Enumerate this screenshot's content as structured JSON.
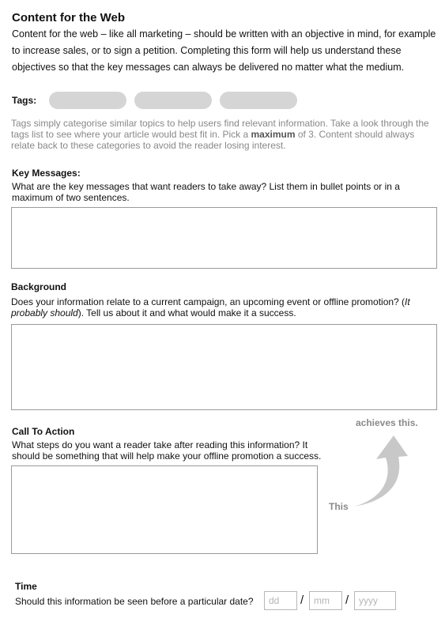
{
  "header": {
    "title": "Content for the Web",
    "intro": "Content for the web – like all marketing – should be written with an objective in mind, for example to increase sales, or to sign a petition. Completing this form will help us understand these objectives so that the key messages can always be delivered no matter what the medium."
  },
  "tags": {
    "label": "Tags:",
    "help_part1": "Tags simply categorise similar topics to help users find relevant information. Take a look through the tags list to see where your article would best fit in. Pick a ",
    "help_bold": "maximum",
    "help_part2": " of 3. Content should always relate back to these categories to avoid the reader losing interest."
  },
  "key_messages": {
    "label": "Key Messages:",
    "help": "What are the key messages that want readers to take away? List them in bullet points or in a maximum of two sentences."
  },
  "background": {
    "label": "Background",
    "help_part1": "Does your information relate to a current campaign, an upcoming event or offline promotion? (",
    "help_italic": "It probably should",
    "help_part2": "). Tell us about it and what would make it a success."
  },
  "call_to_action": {
    "label": "Call To Action",
    "help": "What steps do you want a reader take after reading this information? It should be something that will help make your offline promotion a success.",
    "annotation_top": "achieves this.",
    "annotation_bottom": "This"
  },
  "time": {
    "label": "Time",
    "question": "Should this information be seen before a particular date?",
    "separator": "/",
    "day_placeholder": "dd",
    "month_placeholder": "mm",
    "year_placeholder": "yyyy"
  },
  "colors": {
    "pill": "#d5d5d5",
    "muted_text": "#888888",
    "arrow": "#c8c8c8"
  }
}
